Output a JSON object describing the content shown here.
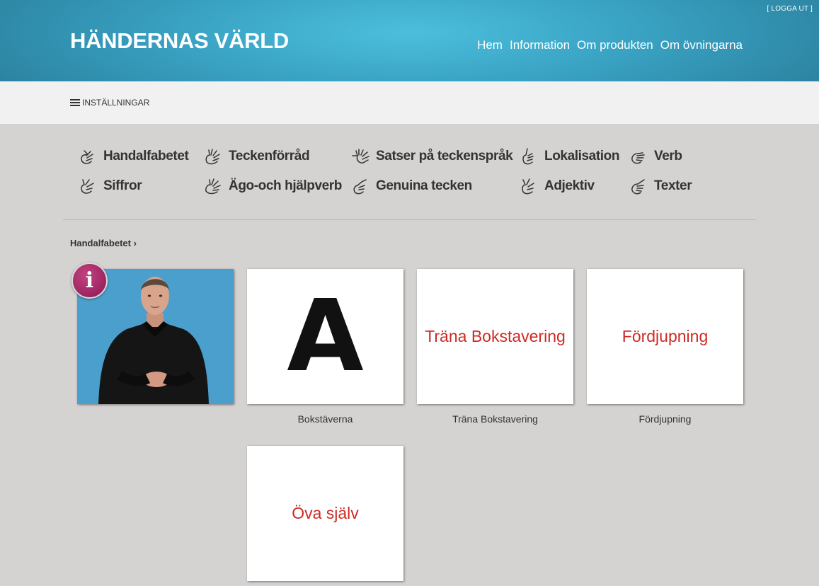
{
  "header": {
    "logout": "[ LOGGA UT ]",
    "brand": "HÄNDERNAS VÄRLD",
    "nav": [
      "Hem",
      "Information",
      "Om produkten",
      "Om övningarna"
    ]
  },
  "settings": {
    "label": "INSTÄLLNINGAR"
  },
  "categories": [
    "Handalfabetet",
    "Teckenförråd",
    "Satser på teckenspråk",
    "Lokalisation",
    "Verb",
    "Siffror",
    "Ägo-och hjälpverb",
    "Genuina tecken",
    "Adjektiv",
    "Texter"
  ],
  "breadcrumb": "Handalfabetet ›",
  "info_badge": "i",
  "cards": {
    "letters": {
      "big": "A",
      "caption": "Bokstäverna"
    },
    "practice": {
      "title": "Träna Bokstavering",
      "caption": "Träna Bokstavering"
    },
    "advanced": {
      "title": "Fördjupning",
      "caption": "Fördjupning"
    },
    "self": {
      "title": "Öva själv"
    }
  },
  "colors": {
    "accent": "#cc2b25",
    "header": "#3aa3c4",
    "info": "#9c2362"
  }
}
